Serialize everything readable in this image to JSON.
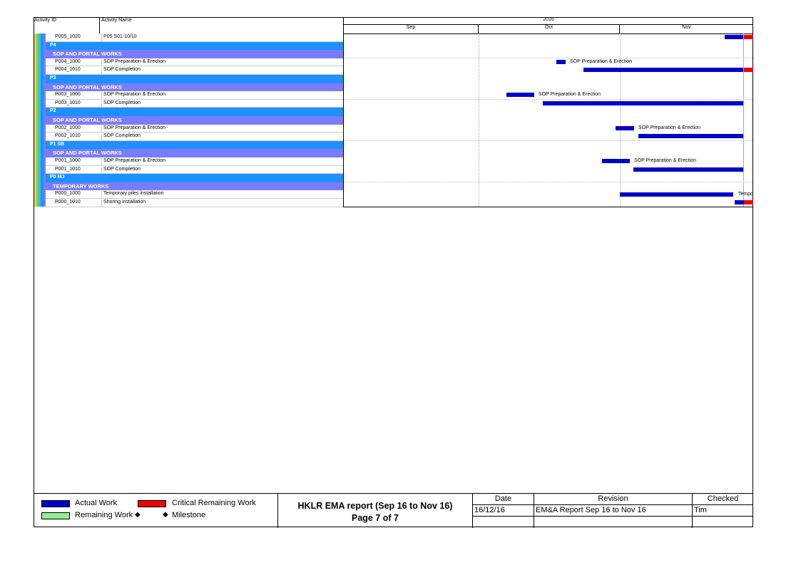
{
  "header": {
    "col_activity_id": "Activity ID",
    "col_activity_name": "Activity Name",
    "year": "2016",
    "months": [
      "Sep",
      "Oct",
      "Nov"
    ]
  },
  "rows": [
    {
      "type": "act",
      "id": "P005_1020",
      "name": "P05 S01-10/10"
    },
    {
      "type": "grp1",
      "label": "P4"
    },
    {
      "type": "grp2",
      "label": "SOP AND PORTAL WORKS"
    },
    {
      "type": "act",
      "id": "P004_1000",
      "name": "SOP Preparation & Erection"
    },
    {
      "type": "act",
      "id": "P004_1010",
      "name": "SOP Completion"
    },
    {
      "type": "grp1",
      "label": "P3"
    },
    {
      "type": "grp2",
      "label": "SOP AND PORTAL WORKS"
    },
    {
      "type": "act",
      "id": "P003_1000",
      "name": "SOP Preparation & Erection"
    },
    {
      "type": "act",
      "id": "P003_1010",
      "name": "SOP Completion"
    },
    {
      "type": "grp1",
      "label": "P2"
    },
    {
      "type": "grp2",
      "label": "SOP AND PORTAL WORKS"
    },
    {
      "type": "act",
      "id": "P002_1000",
      "name": "SOP Preparation & Erection"
    },
    {
      "type": "act",
      "id": "P002_1010",
      "name": "SOP Completion"
    },
    {
      "type": "grp1",
      "label": "P1 SB"
    },
    {
      "type": "grp2",
      "label": "SOP AND PORTAL WORKS"
    },
    {
      "type": "act",
      "id": "P001_1000",
      "name": "SOP Preparation & Erection"
    },
    {
      "type": "act",
      "id": "P001_1010",
      "name": "SOP Completion"
    },
    {
      "type": "grp1",
      "label": "P0 MJ"
    },
    {
      "type": "grp2",
      "label": "TEMPORARY WORKS"
    },
    {
      "type": "act",
      "id": "P000_1000",
      "name": "Temporary piles installation"
    },
    {
      "type": "act",
      "id": "P000_1010",
      "name": "Shoring installation"
    }
  ],
  "bar_labels": {
    "p004_1000": "SOP Preparation & Erection",
    "p003_1000": "SOP Preparation & Erection",
    "p002_1000": "SOP Preparation & Erection",
    "p001_1000": "SOP Preparation & Erection",
    "p000_1000": "Tempo"
  },
  "legend": {
    "actual": "Actual Work",
    "critical": "Critical Remaining Work",
    "remaining": "Remaining Work",
    "milestone": "Milestone",
    "diamond": "◆",
    "colors": {
      "actual": "#0000cc",
      "critical": "#ee0000",
      "remaining": "#90ee90"
    }
  },
  "report": {
    "title": "HKLR EMA report (Sep 16 to Nov 16)",
    "page": "Page 7 of 7"
  },
  "signoff": {
    "date_header": "Date",
    "revision_header": "Revision",
    "checked_header": "Checked",
    "date": "16/12/16",
    "revision": "EM&A Report Sep 16 to Nov 16",
    "checked": "Tim"
  }
}
